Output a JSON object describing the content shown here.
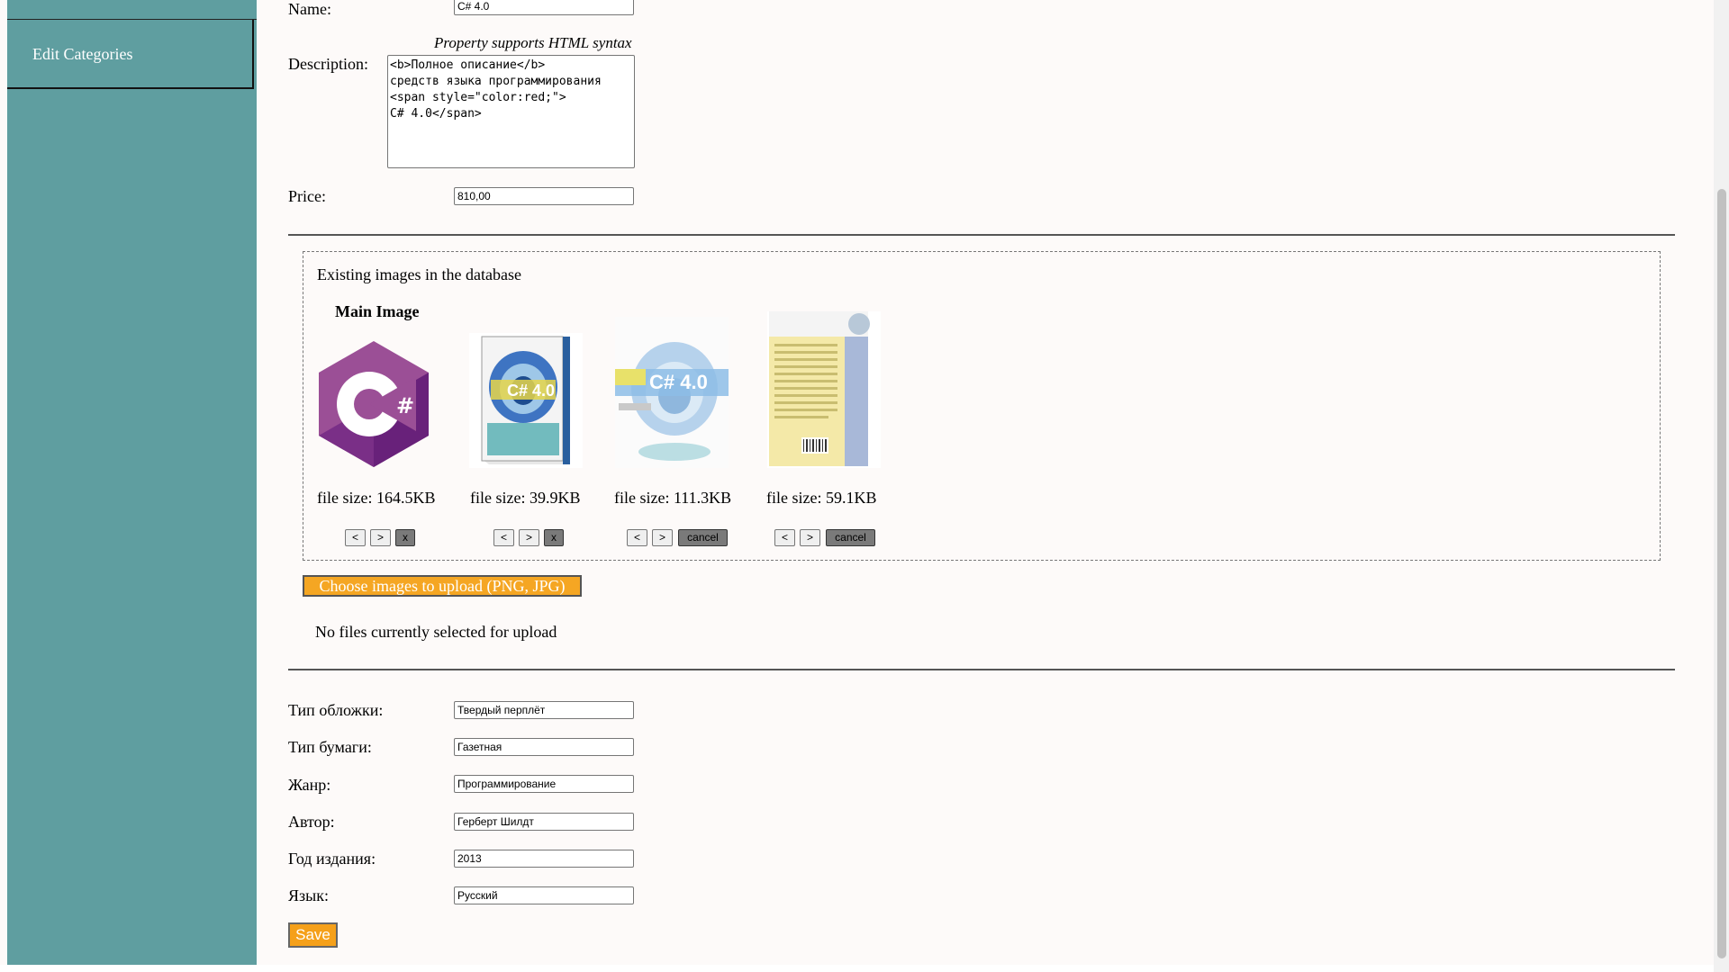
{
  "sidebar": {
    "items": [
      {
        "label": "Edit Categories"
      }
    ]
  },
  "form": {
    "name_label": "Name:",
    "name_value": "C# 4.0",
    "description_note": "Property supports HTML syntax",
    "description_label": "Description:",
    "description_value": "<b>Полное описание</b>\nсредств языка программирования\n<span style=\"color:red;\">\nC# 4.0</span>",
    "price_label": "Price:",
    "price_value": "810,00"
  },
  "images": {
    "title": "Existing images in the database",
    "main_label": "Main Image",
    "items": [
      {
        "file_size": "file size: 164.5KB",
        "left_btn": "<",
        "right_btn": ">",
        "action_btn": "x"
      },
      {
        "file_size": "file size: 39.9KB",
        "left_btn": "<",
        "right_btn": ">",
        "action_btn": "x"
      },
      {
        "file_size": "file size: 111.3KB",
        "left_btn": "<",
        "right_btn": ">",
        "action_btn": "cancel"
      },
      {
        "file_size": "file size: 59.1KB",
        "left_btn": "<",
        "right_btn": ">",
        "action_btn": "cancel"
      }
    ],
    "upload_button": "Choose images to upload (PNG, JPG)",
    "no_files_text": "No files currently selected for upload"
  },
  "properties": [
    {
      "label": "Тип обложки:",
      "value": "Твердый перплёт"
    },
    {
      "label": "Тип бумаги:",
      "value": "Газетная"
    },
    {
      "label": "Жанр:",
      "value": "Программирование"
    },
    {
      "label": "Автор:",
      "value": "Герберт Шилдт"
    },
    {
      "label": "Год издания:",
      "value": "2013"
    },
    {
      "label": "Язык:",
      "value": "Русский"
    }
  ],
  "save_button": "Save",
  "colors": {
    "sidebar": "#5f9ea0",
    "accent": "#f5a623",
    "background": "#fdfaf9"
  }
}
